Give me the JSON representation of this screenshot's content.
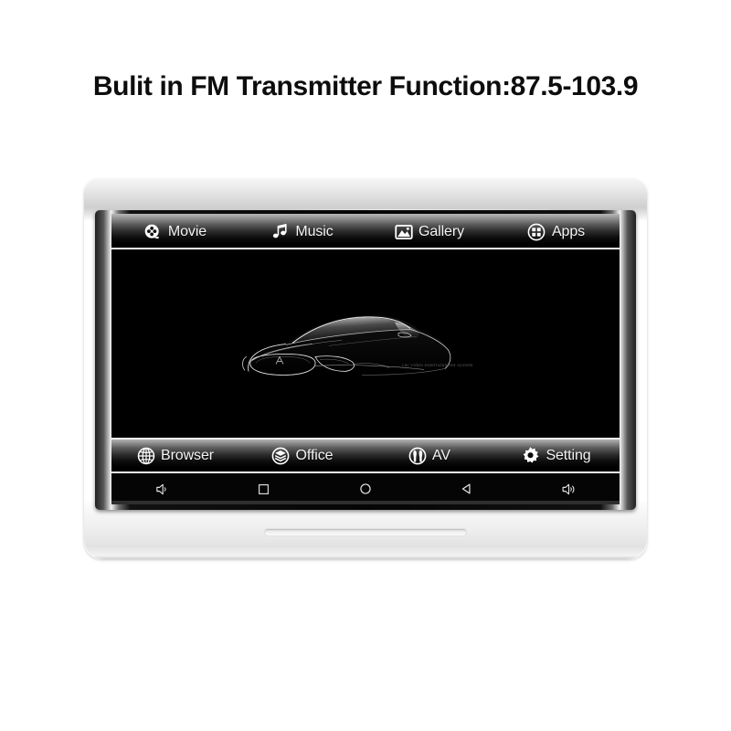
{
  "headline": "Bulit in FM Transmitter Function:87.5-103.9",
  "device": {
    "name": "car-headrest-monitor",
    "speaker_slot": "speaker-slot"
  },
  "screen": {
    "top_menu": [
      {
        "id": "movie",
        "label": "Movie",
        "icon": "film-reel-icon"
      },
      {
        "id": "music",
        "label": "Music",
        "icon": "music-note-icon"
      },
      {
        "id": "gallery",
        "label": "Gallery",
        "icon": "photo-icon"
      },
      {
        "id": "apps",
        "label": "Apps",
        "icon": "apps-grid-icon"
      }
    ],
    "bottom_menu": [
      {
        "id": "browser",
        "label": "Browser",
        "icon": "globe-icon"
      },
      {
        "id": "office",
        "label": "Office",
        "icon": "layers-icon"
      },
      {
        "id": "av",
        "label": "AV",
        "icon": "av-plug-icon"
      },
      {
        "id": "setting",
        "label": "Setting",
        "icon": "gear-icon"
      }
    ],
    "wallpaper": {
      "art": "car-silhouette",
      "caption": "car video entertainment system"
    },
    "nav_bar": [
      {
        "id": "volume-down",
        "icon": "volume-down-icon"
      },
      {
        "id": "recents",
        "icon": "square-recents-icon"
      },
      {
        "id": "home",
        "icon": "circle-home-icon"
      },
      {
        "id": "back",
        "icon": "triangle-back-icon"
      },
      {
        "id": "volume-up",
        "icon": "volume-up-icon"
      }
    ]
  },
  "colors": {
    "page_background": "#ffffff",
    "headline_text": "#0d0d0d",
    "screen_background": "#000000",
    "menu_text": "#f5f5f5",
    "bezel_white": "#f2f2f2",
    "separator": "#f0f0f0"
  }
}
